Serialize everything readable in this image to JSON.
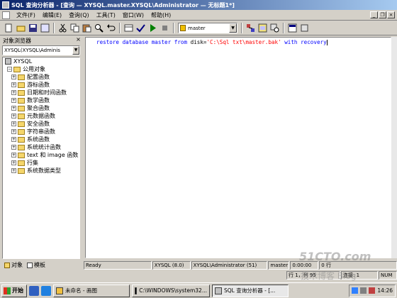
{
  "window": {
    "title": "SQL 查询分析器 - [查询 — XYSQL.master.XYSQL\\Administrator — 无标题1*]"
  },
  "menu": [
    "文件(F)",
    "编辑(E)",
    "查询(Q)",
    "工具(T)",
    "窗口(W)",
    "帮助(H)"
  ],
  "toolbar": {
    "database": "master"
  },
  "object_browser": {
    "title": "对象浏览器",
    "close_glyph": "×",
    "server": "XYSQL(XYSQL\\Adminis",
    "root": "XYSQL",
    "common_objects": "公用对象",
    "items": [
      "配置函数",
      "游标函数",
      "日期和时间函数",
      "数学函数",
      "聚合函数",
      "元数据函数",
      "安全函数",
      "字符串函数",
      "系统函数",
      "系统统计函数",
      "text 和 image 函数",
      "行集",
      "系统数据类型"
    ],
    "tabs": [
      "对象",
      "模板"
    ]
  },
  "editor": {
    "kw1": "restore",
    "p1": " database master ",
    "kw2": "from",
    "p2": " disk=",
    "str": "'C:\\Sql txt\\master.bak'",
    "p3": " ",
    "kw3": "with",
    "p4": " recovery"
  },
  "status": {
    "ready": "Ready",
    "server": "XYSQL (8.0)",
    "user": "XYSQL\\Administrator (51)",
    "db": "master",
    "time": "0:00:00",
    "rows": "0 行",
    "pos": "行 1，列 95",
    "connections": "连接: 1",
    "num": "NUM"
  },
  "taskbar": {
    "start": "开始",
    "tasks": [
      "未命名 - 画图",
      "C:\\WINDOWS\\system32...",
      "SQL 查询分析器 - [..."
    ],
    "clock": "14:26"
  },
  "watermark": {
    "line1": "51CTO.com",
    "line2": "技术博客 Blog"
  }
}
